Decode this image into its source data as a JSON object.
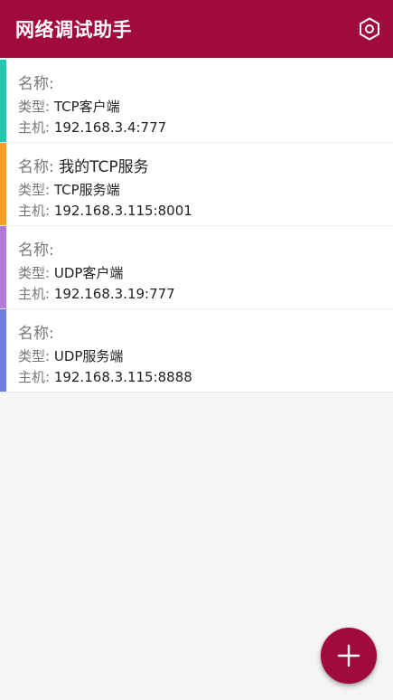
{
  "app": {
    "title": "网络调试助手"
  },
  "icons": {
    "settings": "hexagon-gear-icon",
    "add": "plus-icon"
  },
  "colors": {
    "primary": "#a10a3c",
    "background": "#f5f5f5"
  },
  "connections": [
    {
      "name_label": "名称:",
      "name": "",
      "type_label": "类型:",
      "type": "TCP客户端",
      "host_label": "主机:",
      "host": "192.168.3.4:777",
      "color": "#26c6b0"
    },
    {
      "name_label": "名称:",
      "name": "我的TCP服务",
      "type_label": "类型:",
      "type": "TCP服务端",
      "host_label": "主机:",
      "host": "192.168.3.115:8001",
      "color": "#f5a025"
    },
    {
      "name_label": "名称:",
      "name": "",
      "type_label": "类型:",
      "type": "UDP客户端",
      "host_label": "主机:",
      "host": "192.168.3.19:777",
      "color": "#b07ad6"
    },
    {
      "name_label": "名称:",
      "name": "",
      "type_label": "类型:",
      "type": "UDP服务端",
      "host_label": "主机:",
      "host": "192.168.3.115:8888",
      "color": "#6e7fe0"
    }
  ]
}
